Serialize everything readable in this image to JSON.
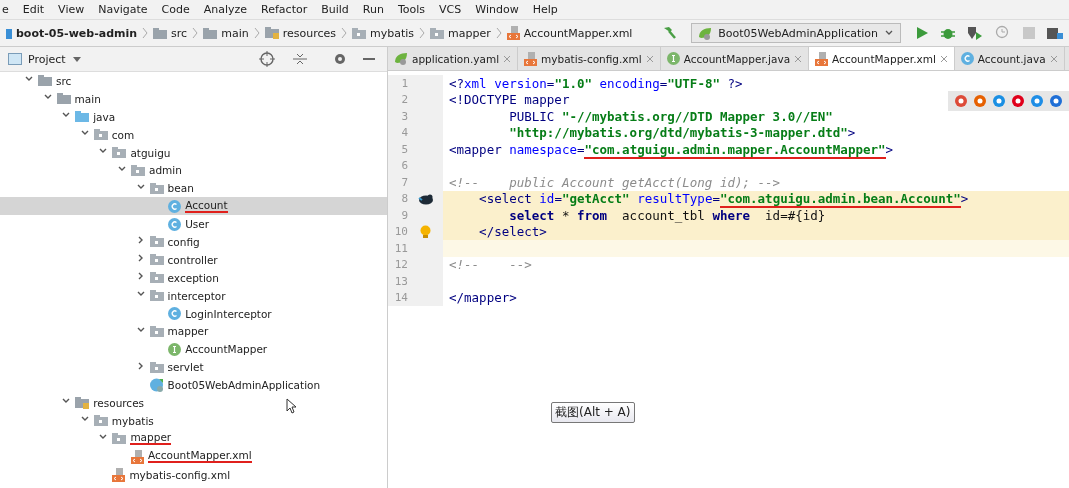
{
  "menu": [
    "e",
    "Edit",
    "View",
    "Navigate",
    "Code",
    "Analyze",
    "Refactor",
    "Build",
    "Run",
    "Tools",
    "VCS",
    "Window",
    "Help"
  ],
  "breadcrumbs": [
    {
      "label": "boot-05-web-admin",
      "kind": "module"
    },
    {
      "label": "src",
      "kind": "folder"
    },
    {
      "label": "main",
      "kind": "folder"
    },
    {
      "label": "resources",
      "kind": "resources"
    },
    {
      "label": "mybatis",
      "kind": "package"
    },
    {
      "label": "mapper",
      "kind": "package"
    },
    {
      "label": "AccountMapper.xml",
      "kind": "xml"
    }
  ],
  "run_config": {
    "label": "Boot05WebAdminApplication"
  },
  "project_panel": {
    "title": "Project",
    "tree": [
      {
        "label": "src",
        "kind": "folder",
        "expanded": true,
        "selected": false,
        "annotated": false,
        "children": [
          {
            "label": "main",
            "kind": "folder",
            "expanded": true,
            "selected": false,
            "annotated": false,
            "children": [
              {
                "label": "java",
                "kind": "source",
                "expanded": true,
                "selected": false,
                "annotated": false,
                "children": [
                  {
                    "label": "com",
                    "kind": "package",
                    "expanded": true,
                    "selected": false,
                    "annotated": false,
                    "children": [
                      {
                        "label": "atguigu",
                        "kind": "package",
                        "expanded": true,
                        "selected": false,
                        "annotated": false,
                        "children": [
                          {
                            "label": "admin",
                            "kind": "package",
                            "expanded": true,
                            "selected": false,
                            "annotated": false,
                            "children": [
                              {
                                "label": "bean",
                                "kind": "package",
                                "expanded": true,
                                "selected": false,
                                "annotated": false,
                                "children": [
                                  {
                                    "label": "Account",
                                    "kind": "class",
                                    "selected": true,
                                    "annotated": true
                                  },
                                  {
                                    "label": "User",
                                    "kind": "class",
                                    "selected": false,
                                    "annotated": false
                                  }
                                ]
                              },
                              {
                                "label": "config",
                                "kind": "package",
                                "expanded": false,
                                "selected": false,
                                "annotated": false
                              },
                              {
                                "label": "controller",
                                "kind": "package",
                                "expanded": false,
                                "selected": false,
                                "annotated": false
                              },
                              {
                                "label": "exception",
                                "kind": "package",
                                "expanded": false,
                                "selected": false,
                                "annotated": false
                              },
                              {
                                "label": "interceptor",
                                "kind": "package",
                                "expanded": true,
                                "selected": false,
                                "annotated": false,
                                "children": [
                                  {
                                    "label": "LoginInterceptor",
                                    "kind": "class",
                                    "selected": false,
                                    "annotated": false
                                  }
                                ]
                              },
                              {
                                "label": "mapper",
                                "kind": "package",
                                "expanded": true,
                                "selected": false,
                                "annotated": false,
                                "children": [
                                  {
                                    "label": "AccountMapper",
                                    "kind": "interface",
                                    "selected": false,
                                    "annotated": false
                                  }
                                ]
                              },
                              {
                                "label": "servlet",
                                "kind": "package",
                                "expanded": false,
                                "selected": false,
                                "annotated": false
                              },
                              {
                                "label": "Boot05WebAdminApplication",
                                "kind": "boot",
                                "selected": false,
                                "annotated": false
                              }
                            ]
                          }
                        ]
                      }
                    ]
                  }
                ]
              },
              {
                "label": "resources",
                "kind": "resources",
                "expanded": true,
                "selected": false,
                "annotated": false,
                "children": [
                  {
                    "label": "mybatis",
                    "kind": "package",
                    "expanded": true,
                    "selected": false,
                    "annotated": false,
                    "children": [
                      {
                        "label": "mapper",
                        "kind": "package",
                        "expanded": true,
                        "selected": false,
                        "annotated": true,
                        "children": [
                          {
                            "label": "AccountMapper.xml",
                            "kind": "xml",
                            "selected": false,
                            "annotated": true
                          }
                        ]
                      },
                      {
                        "label": "mybatis-config.xml",
                        "kind": "xml",
                        "selected": false,
                        "annotated": false
                      }
                    ]
                  }
                ]
              }
            ]
          }
        ]
      }
    ]
  },
  "editor_tabs": [
    {
      "label": "application.yaml",
      "kind": "yaml",
      "selected": false
    },
    {
      "label": "mybatis-config.xml",
      "kind": "xml",
      "selected": false
    },
    {
      "label": "AccountMapper.java",
      "kind": "interface",
      "selected": false
    },
    {
      "label": "AccountMapper.xml",
      "kind": "xml",
      "selected": true
    },
    {
      "label": "Account.java",
      "kind": "class",
      "selected": false
    }
  ],
  "code_lines": [
    {
      "number": "1",
      "kind": "plain",
      "highlighted": false,
      "current": false,
      "tokens": [
        {
          "kind": "punct",
          "text": "<?"
        },
        {
          "kind": "attr",
          "text": "xml version"
        },
        {
          "kind": "punct",
          "text": "="
        },
        {
          "kind": "string",
          "text": "\"1.0\""
        },
        {
          "kind": "attr",
          "text": " encoding"
        },
        {
          "kind": "punct",
          "text": "="
        },
        {
          "kind": "string",
          "text": "\"UTF-8\""
        },
        {
          "kind": "punct",
          "text": " ?>"
        }
      ]
    },
    {
      "number": "2",
      "kind": "plain",
      "highlighted": false,
      "current": false,
      "tokens": [
        {
          "kind": "tag",
          "text": "<!DOCTYPE mapper"
        }
      ]
    },
    {
      "number": "3",
      "kind": "plain",
      "highlighted": false,
      "current": false,
      "tokens": [
        {
          "kind": "tag",
          "text": "        PUBLIC "
        },
        {
          "kind": "string",
          "text": "\"-//mybatis.org//DTD Mapper 3.0//EN\""
        }
      ]
    },
    {
      "number": "4",
      "kind": "plain",
      "highlighted": false,
      "current": false,
      "tokens": [
        {
          "kind": "string",
          "text": "        \"http://mybatis.org/dtd/mybatis-3-mapper.dtd\""
        },
        {
          "kind": "tag",
          "text": ">"
        }
      ]
    },
    {
      "number": "5",
      "kind": "plain",
      "highlighted": false,
      "current": false,
      "tokens": [
        {
          "kind": "tag",
          "text": "<mapper "
        },
        {
          "kind": "attr",
          "text": "namespace"
        },
        {
          "kind": "punct",
          "text": "="
        },
        {
          "kind": "string",
          "text": "\"com.atguigu.admin.mapper.AccountMapper\"",
          "annotated": true
        },
        {
          "kind": "tag",
          "text": ">"
        }
      ]
    },
    {
      "number": "6",
      "kind": "plain",
      "highlighted": false,
      "current": false
    },
    {
      "number": "7",
      "kind": "plain",
      "highlighted": false,
      "current": false,
      "tokens": [
        {
          "kind": "comment",
          "text": "<!--    public Account getAcct(Long id); -->"
        }
      ]
    },
    {
      "number": "8",
      "kind": "mapper-marker",
      "highlighted": true,
      "current": false,
      "tokens": [
        {
          "kind": "tag",
          "text": "    <select "
        },
        {
          "kind": "attr",
          "text": "id"
        },
        {
          "kind": "punct",
          "text": "="
        },
        {
          "kind": "string",
          "text": "\"getAcct\""
        },
        {
          "kind": "attr",
          "text": " resultType"
        },
        {
          "kind": "punct",
          "text": "="
        },
        {
          "kind": "string",
          "text": "\"com.atguigu.admin.bean.Account\"",
          "annotated": true
        },
        {
          "kind": "tag",
          "text": ">"
        }
      ]
    },
    {
      "number": "9",
      "kind": "plain",
      "highlighted": true,
      "current": false,
      "tokens": [
        {
          "kind": "keyword",
          "text": "        select"
        },
        {
          "kind": "text",
          "text": " * "
        },
        {
          "kind": "keyword",
          "text": "from"
        },
        {
          "kind": "text",
          "text": "  account_tbl "
        },
        {
          "kind": "keyword",
          "text": "where"
        },
        {
          "kind": "text",
          "text": "  id=#{id}"
        }
      ]
    },
    {
      "number": "10",
      "kind": "intention",
      "highlighted": true,
      "current": false,
      "tokens": [
        {
          "kind": "tag",
          "text": "    </select>"
        }
      ]
    },
    {
      "number": "11",
      "kind": "plain",
      "highlighted": false,
      "current": true
    },
    {
      "number": "12",
      "kind": "plain",
      "highlighted": false,
      "current": false,
      "tokens": [
        {
          "kind": "comment",
          "text": "<!--    -->"
        }
      ]
    },
    {
      "number": "13",
      "kind": "plain",
      "highlighted": false,
      "current": false
    },
    {
      "number": "14",
      "kind": "plain",
      "highlighted": false,
      "current": false,
      "tokens": [
        {
          "kind": "tag",
          "text": "</mapper>"
        }
      ]
    }
  ],
  "tooltip": {
    "text": "截图(Alt + A)"
  }
}
